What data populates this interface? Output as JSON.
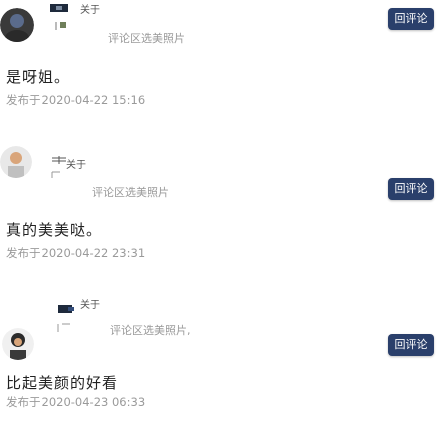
{
  "reply_label": "回评论",
  "feed": [
    {
      "thumb_title": "关于",
      "subtitle": "评论区选美照片",
      "comment": "是呀姐。",
      "meta_label": "发布于",
      "date": "2020-04-22 15:16"
    },
    {
      "thumb_title": "关于",
      "subtitle": "评论区选美照片",
      "comment": "真的美美哒。",
      "meta_label": "发布于",
      "date": "2020-04-22 23:31"
    },
    {
      "thumb_title": "关于",
      "subtitle": "评论区选美照片,",
      "comment": "比起美颜的好看",
      "meta_label": "发布于",
      "date": "2020-04-23 06:33"
    }
  ]
}
